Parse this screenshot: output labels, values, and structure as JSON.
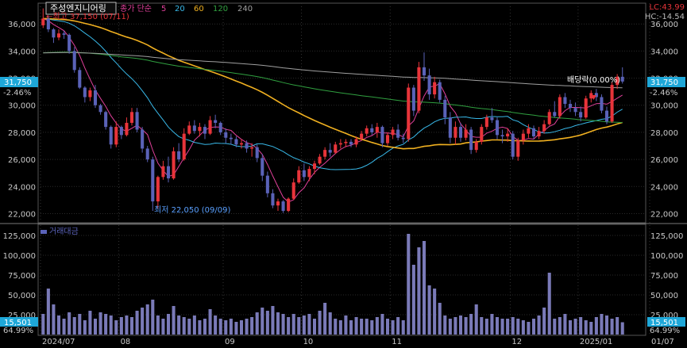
{
  "header": {
    "stock_name": "주성엔지니어링",
    "ma_label": "종가 단순",
    "ma_periods": [
      "5",
      "20",
      "60",
      "120",
      "240"
    ],
    "ma_colors": [
      "#e0409a",
      "#38b8e8",
      "#f0b020",
      "#30a040",
      "#a0a0a0"
    ],
    "lc": "LC:43.99",
    "hc": "HC:-14.54"
  },
  "volume_panel": {
    "title": "거래대금",
    "current_value": "15,501",
    "current_pct": "64.99%"
  },
  "annotations": {
    "high": "←최고 37,150 (07/11)",
    "low": "최저 22,050 (09/09)",
    "dividend": "배당락(0.00%)"
  },
  "current_price": {
    "value": "31,750",
    "change": "-2.46%"
  },
  "chart_data": {
    "type": "candlestick",
    "price_axis": {
      "ticks": [
        "36,000",
        "34,000",
        "32,000",
        "30,000",
        "28,000",
        "26,000",
        "24,000",
        "22,000"
      ],
      "range": [
        21500,
        37300
      ]
    },
    "volume_axis": {
      "ticks": [
        "125,000",
        "100,000",
        "75,000",
        "50,000",
        "25,000"
      ],
      "range": [
        0,
        135000
      ]
    },
    "x_labels": [
      "2024/07",
      "08",
      "09",
      "10",
      "11",
      "12",
      "2025/01",
      "01/07"
    ],
    "colors": {
      "up": "#e8343a",
      "down": "#5a62b8",
      "volume": "#7a7ab8"
    },
    "candles": [
      [
        35900,
        37150,
        35700,
        36400
      ],
      [
        36400,
        36600,
        35400,
        35600
      ],
      [
        35600,
        35700,
        34600,
        35000
      ],
      [
        35000,
        35600,
        34800,
        35300
      ],
      [
        35300,
        35500,
        34900,
        35200
      ],
      [
        35200,
        35300,
        33800,
        34000
      ],
      [
        34000,
        34300,
        32400,
        32600
      ],
      [
        32600,
        32800,
        31200,
        31300
      ],
      [
        31300,
        31400,
        30200,
        30600
      ],
      [
        30600,
        31300,
        30300,
        31100
      ],
      [
        31100,
        31500,
        29800,
        30000
      ],
      [
        30000,
        30100,
        29300,
        29500
      ],
      [
        29500,
        29600,
        28200,
        28400
      ],
      [
        28400,
        28500,
        26800,
        27100
      ],
      [
        27100,
        28800,
        26900,
        28400
      ],
      [
        28400,
        28500,
        27500,
        27800
      ],
      [
        27800,
        29100,
        27700,
        28700
      ],
      [
        28700,
        29800,
        28500,
        29500
      ],
      [
        29500,
        29800,
        28000,
        28200
      ],
      [
        28200,
        28400,
        26500,
        26800
      ],
      [
        26800,
        27000,
        25800,
        26000
      ],
      [
        26000,
        26200,
        22200,
        22900
      ],
      [
        22900,
        24800,
        22400,
        24700
      ],
      [
        24700,
        25900,
        24500,
        25500
      ],
      [
        25500,
        26200,
        24300,
        24600
      ],
      [
        24600,
        26900,
        24500,
        26600
      ],
      [
        26600,
        27200,
        25800,
        26000
      ],
      [
        26000,
        28300,
        25900,
        27900
      ],
      [
        27900,
        28800,
        27800,
        28500
      ],
      [
        28500,
        28900,
        27900,
        28100
      ],
      [
        28100,
        28700,
        27700,
        28400
      ],
      [
        28400,
        28600,
        27500,
        27900
      ],
      [
        27900,
        29200,
        27800,
        28900
      ],
      [
        28900,
        29300,
        28300,
        28700
      ],
      [
        28700,
        28800,
        27800,
        28000
      ],
      [
        28000,
        28300,
        27200,
        27600
      ],
      [
        27600,
        27900,
        27100,
        27500
      ],
      [
        27500,
        27700,
        26900,
        27100
      ],
      [
        27100,
        27500,
        26800,
        27200
      ],
      [
        27200,
        27400,
        26500,
        26800
      ],
      [
        26800,
        27200,
        26200,
        26900
      ],
      [
        26900,
        27100,
        25800,
        26100
      ],
      [
        26100,
        26400,
        24400,
        24800
      ],
      [
        24800,
        25100,
        23200,
        23500
      ],
      [
        23500,
        23800,
        22400,
        22600
      ],
      [
        22600,
        23100,
        22200,
        22900
      ],
      [
        22900,
        23000,
        22050,
        22200
      ],
      [
        22200,
        23200,
        22100,
        23100
      ],
      [
        23100,
        24600,
        23000,
        24300
      ],
      [
        24300,
        25500,
        24200,
        25200
      ],
      [
        25200,
        25700,
        24400,
        24700
      ],
      [
        24700,
        25500,
        24400,
        25300
      ],
      [
        25300,
        25900,
        24900,
        25700
      ],
      [
        25700,
        26400,
        25600,
        26200
      ],
      [
        26200,
        26900,
        26000,
        26700
      ],
      [
        26700,
        27200,
        26200,
        26500
      ],
      [
        26500,
        27300,
        26400,
        27100
      ],
      [
        27100,
        27500,
        26800,
        27200
      ],
      [
        27200,
        27500,
        26900,
        27300
      ],
      [
        27300,
        27500,
        26900,
        27100
      ],
      [
        27100,
        27700,
        26900,
        27500
      ],
      [
        27500,
        28100,
        27400,
        27900
      ],
      [
        27900,
        28500,
        27700,
        28300
      ],
      [
        28300,
        28600,
        27800,
        28000
      ],
      [
        28000,
        28700,
        27600,
        28400
      ],
      [
        28400,
        28500,
        26900,
        27200
      ],
      [
        27200,
        28000,
        27000,
        27800
      ],
      [
        27800,
        28400,
        27500,
        28200
      ],
      [
        28200,
        28600,
        27400,
        27600
      ],
      [
        27600,
        27900,
        27200,
        27500
      ],
      [
        27500,
        31600,
        27300,
        31300
      ],
      [
        31300,
        31500,
        29200,
        29600
      ],
      [
        29600,
        33200,
        29400,
        32800
      ],
      [
        32800,
        33900,
        31800,
        32200
      ],
      [
        32200,
        32700,
        30400,
        30800
      ],
      [
        30800,
        32100,
        30500,
        31700
      ],
      [
        31700,
        31900,
        30200,
        30400
      ],
      [
        30400,
        30700,
        28600,
        29100
      ],
      [
        29100,
        29500,
        27200,
        27600
      ],
      [
        27600,
        28800,
        27100,
        28400
      ],
      [
        28400,
        28700,
        27300,
        27600
      ],
      [
        27600,
        28600,
        27400,
        28200
      ],
      [
        28200,
        28400,
        26400,
        26700
      ],
      [
        26700,
        27500,
        26500,
        27300
      ],
      [
        27300,
        28600,
        27100,
        28400
      ],
      [
        28400,
        29300,
        28200,
        29100
      ],
      [
        29100,
        29800,
        28700,
        28900
      ],
      [
        28900,
        29100,
        27500,
        27800
      ],
      [
        27800,
        28200,
        27200,
        27700
      ],
      [
        27700,
        28300,
        27300,
        27900
      ],
      [
        27900,
        28100,
        26000,
        26200
      ],
      [
        26200,
        27600,
        25900,
        27400
      ],
      [
        27400,
        28200,
        27100,
        27900
      ],
      [
        27900,
        28600,
        27600,
        28300
      ],
      [
        28300,
        28500,
        27500,
        27700
      ],
      [
        27700,
        28400,
        27500,
        28100
      ],
      [
        28100,
        28900,
        27900,
        28600
      ],
      [
        28600,
        29700,
        28500,
        29500
      ],
      [
        29500,
        30300,
        29100,
        29200
      ],
      [
        29200,
        30800,
        29000,
        30600
      ],
      [
        30600,
        30900,
        29800,
        30100
      ],
      [
        30100,
        30400,
        29500,
        29800
      ],
      [
        29800,
        30200,
        29200,
        29500
      ],
      [
        29500,
        29900,
        28800,
        29100
      ],
      [
        29100,
        30700,
        29000,
        30500
      ],
      [
        30500,
        31100,
        30200,
        30900
      ],
      [
        30900,
        31200,
        30300,
        30600
      ],
      [
        30600,
        30800,
        29400,
        29600
      ],
      [
        29600,
        29900,
        28600,
        28800
      ],
      [
        28800,
        31700,
        28700,
        31500
      ],
      [
        31500,
        32300,
        31200,
        32100
      ],
      [
        32100,
        32800,
        31600,
        31750
      ]
    ],
    "volume": [
      26000,
      58000,
      38000,
      24000,
      20000,
      28000,
      22000,
      26000,
      18000,
      30000,
      20000,
      28000,
      26000,
      24000,
      18000,
      22000,
      24000,
      22000,
      30000,
      34000,
      38000,
      44000,
      24000,
      20000,
      26000,
      36000,
      24000,
      22000,
      20000,
      24000,
      18000,
      20000,
      32000,
      24000,
      20000,
      18000,
      20000,
      16000,
      18000,
      20000,
      22000,
      28000,
      34000,
      30000,
      36000,
      28000,
      26000,
      22000,
      26000,
      22000,
      24000,
      26000,
      20000,
      30000,
      40000,
      28000,
      20000,
      18000,
      24000,
      18000,
      22000,
      20000,
      20000,
      18000,
      22000,
      26000,
      20000,
      18000,
      22000,
      18000,
      127000,
      88000,
      110000,
      118000,
      62000,
      58000,
      40000,
      24000,
      20000,
      22000,
      24000,
      22000,
      26000,
      38000,
      22000,
      20000,
      26000,
      22000,
      20000,
      20000,
      22000,
      20000,
      18000,
      16000,
      20000,
      24000,
      34000,
      78000,
      20000,
      22000,
      26000,
      18000,
      20000,
      22000,
      18000,
      16000,
      22000,
      26000,
      24000,
      20000,
      22000,
      15501
    ]
  }
}
